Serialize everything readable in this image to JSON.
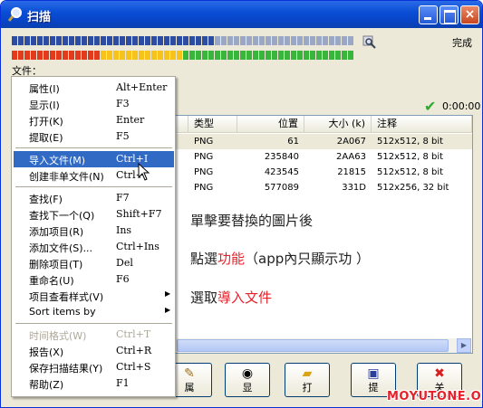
{
  "window": {
    "title": "扫描",
    "status": "完成",
    "file_label": "文件：",
    "elapsed": "0:00:00",
    "progress_pct": 100
  },
  "progress": {
    "top_colors": [
      "#2d4da3",
      "#9aa8c6"
    ],
    "bottom_colors": [
      "#e23a1b",
      "#f7c21a",
      "#39b53b"
    ]
  },
  "columns": [
    "",
    "类型",
    "位置",
    "大小 (k)",
    "注释"
  ],
  "rows": [
    {
      "type": "PNG",
      "pos": "61",
      "size": "2A067",
      "note": "512x512, 8 bit"
    },
    {
      "type": "PNG",
      "pos": "235840",
      "size": "2AA63",
      "note": "512x512, 8 bit"
    },
    {
      "type": "PNG",
      "pos": "423545",
      "size": "21815",
      "note": "512x512, 8 bit"
    },
    {
      "type": "PNG",
      "pos": "577089",
      "size": "331D",
      "note": "512x256, 32 bit"
    }
  ],
  "annotations": [
    {
      "text": "單擊要替換的圖片後",
      "highlight": "",
      "after": ""
    },
    {
      "text": "點選",
      "highlight": "功能",
      "after": "（app內只顯示功 ）"
    },
    {
      "text": "選取",
      "highlight": "導入文件",
      "after": ""
    }
  ],
  "buttons": [
    {
      "label": "属",
      "icon": "properties-icon",
      "glyph": "✎"
    },
    {
      "label": "显",
      "icon": "eye-icon",
      "glyph": "👁"
    },
    {
      "label": "打",
      "icon": "folder-open-icon",
      "glyph": "📂"
    },
    {
      "label": "提",
      "icon": "save-icon",
      "glyph": "💾"
    },
    {
      "label": "关",
      "icon": "close-icon",
      "glyph": "✖"
    }
  ],
  "menu": [
    {
      "label": "属性(I)",
      "shortcut": "Alt+Enter"
    },
    {
      "label": "显示(I)",
      "shortcut": "F3"
    },
    {
      "label": "打开(K)",
      "shortcut": "Enter"
    },
    {
      "label": "提取(E)",
      "shortcut": "F5"
    },
    {
      "sep": true
    },
    {
      "label": "导入文件(M)",
      "shortcut": "Ctrl+I",
      "selected": true
    },
    {
      "label": "创建非单文件(N)",
      "shortcut": "Ctrl+"
    },
    {
      "sep": true
    },
    {
      "label": "查找(F)",
      "shortcut": "F7"
    },
    {
      "label": "查找下一个(Q)",
      "shortcut": "Shift+F7"
    },
    {
      "label": "添加项目(R)",
      "shortcut": "Ins"
    },
    {
      "label": "添加文件(S)...",
      "shortcut": "Ctrl+Ins"
    },
    {
      "label": "删除项目(T)",
      "shortcut": "Del"
    },
    {
      "label": "重命名(U)",
      "shortcut": "F6"
    },
    {
      "label": "项目查看样式(V)",
      "shortcut": "",
      "submenu": true
    },
    {
      "label": "Sort items by",
      "shortcut": "",
      "submenu": true
    },
    {
      "sep": true
    },
    {
      "label": "时间格式(W)",
      "shortcut": "Ctrl+T",
      "disabled": true
    },
    {
      "label": "报告(X)",
      "shortcut": "Ctrl+R"
    },
    {
      "label": "保存扫描结果(Y)",
      "shortcut": "Ctrl+S"
    },
    {
      "label": "帮助(Z)",
      "shortcut": "F1"
    }
  ],
  "watermark": "MOYUTONE.ORG"
}
